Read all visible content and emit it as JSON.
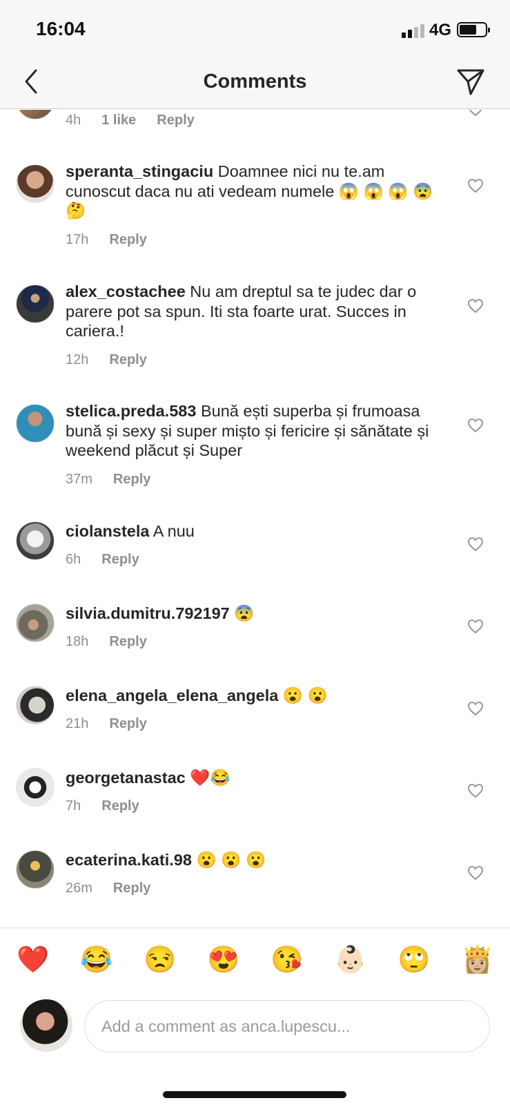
{
  "status_bar": {
    "time": "16:04",
    "network": "4G"
  },
  "header": {
    "title": "Comments"
  },
  "partial_comment": {
    "time": "4h",
    "likes": "1 like",
    "reply": "Reply"
  },
  "comments": [
    {
      "user": "speranta_stingaciu",
      "text": "Doamnee nici nu te.am cunoscut  daca nu ati vedeam numele 😱 😱 😱 😨 🤔",
      "time": "17h",
      "reply": "Reply"
    },
    {
      "user": "alex_costachee",
      "text": "Nu am dreptul sa te judec dar o parere pot sa spun.  Iti sta foarte urat. Succes in cariera.!",
      "time": "12h",
      "reply": "Reply"
    },
    {
      "user": "stelica.preda.583",
      "text": "Bună ești superba și frumoasa bună și sexy și super mișto și fericire și sănătate și weekend plăcut și Super",
      "time": "37m",
      "reply": "Reply"
    },
    {
      "user": "ciolanstela",
      "text": "A nuu",
      "time": "6h",
      "reply": "Reply"
    },
    {
      "user": "silvia.dumitru.792197",
      "text": "😨",
      "time": "18h",
      "reply": "Reply"
    },
    {
      "user": "elena_angela_elena_angela",
      "text": "😮 😮",
      "time": "21h",
      "reply": "Reply"
    },
    {
      "user": "georgetanastac",
      "text": "❤️😂",
      "time": "7h",
      "reply": "Reply"
    },
    {
      "user": "ecaterina.kati.98",
      "text": "😮 😮 😮",
      "time": "26m",
      "reply": "Reply"
    }
  ],
  "emoji_bar": [
    "❤️",
    "😂",
    "😒",
    "😍",
    "😘",
    "👶🏻",
    "🙄",
    "👸🏼"
  ],
  "composer": {
    "placeholder": "Add a comment as anca.lupescu..."
  },
  "colors": {
    "text": "#262626",
    "secondary": "#8e8e8e",
    "bar_bg": "#f7f7f7"
  }
}
